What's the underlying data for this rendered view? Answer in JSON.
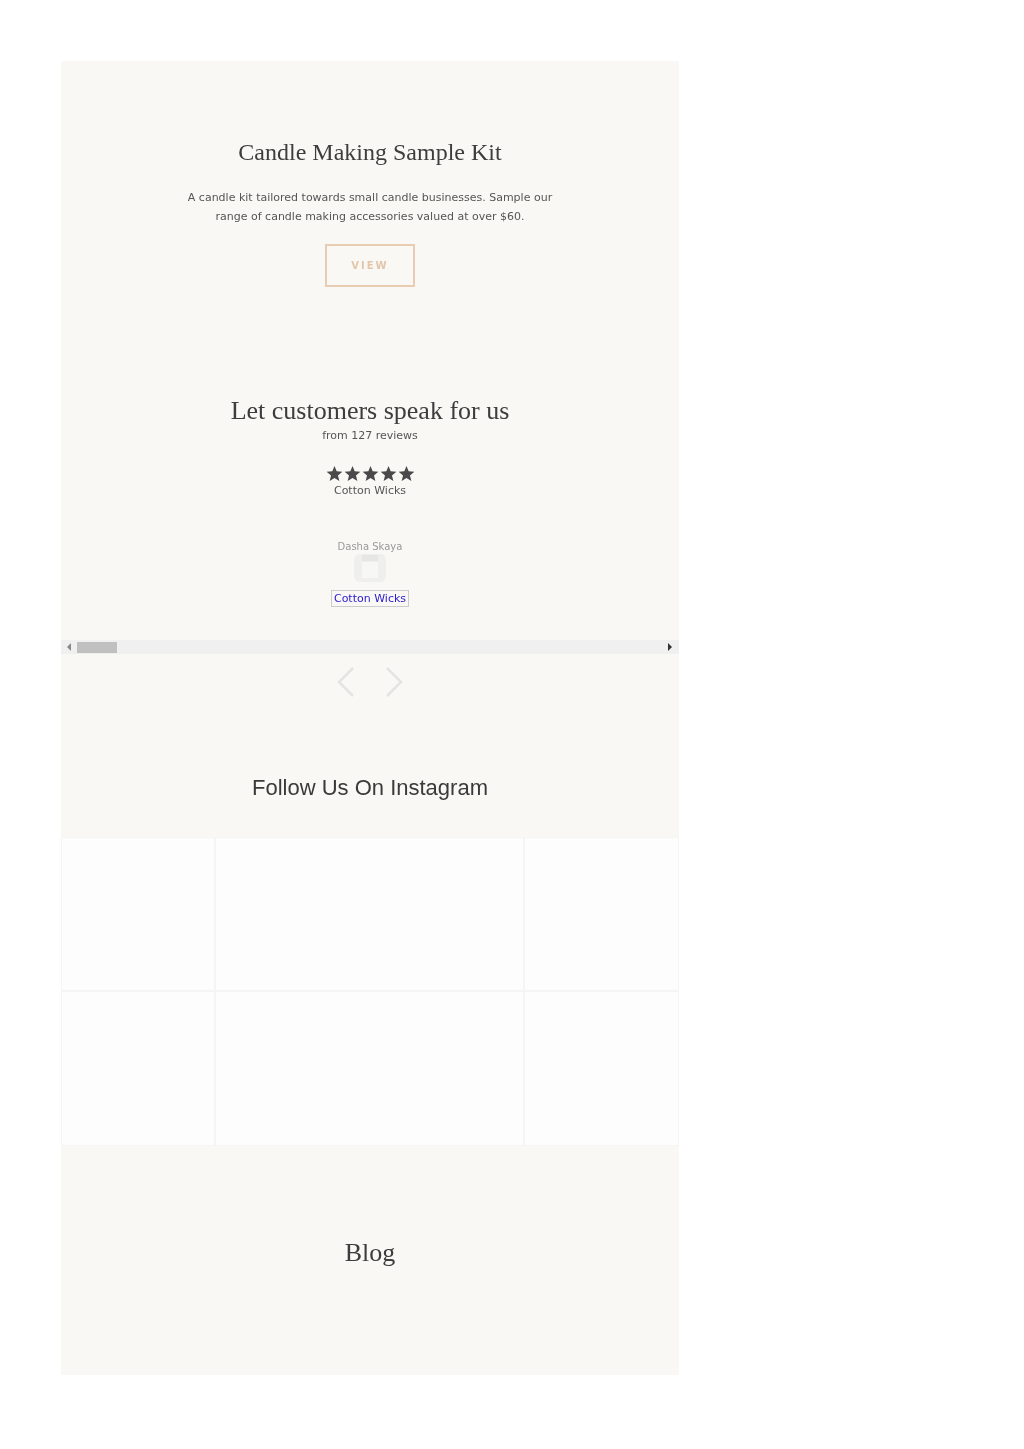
{
  "hero": {
    "title": "Candle Making Sample Kit",
    "description": "A candle kit tailored towards small candle businesses. Sample our range of candle making accessories valued at over $60.",
    "button": "VIEW"
  },
  "reviews": {
    "title": "Let customers speak for us",
    "subtitle": "from 127 reviews",
    "items": [
      {
        "stars": 5,
        "product": "Cotton Wicks",
        "author": "Dasha Skaya",
        "link": "Cotton Wicks"
      }
    ]
  },
  "instagram": {
    "title": "Follow Us On Instagram"
  },
  "blog": {
    "title": "Blog"
  }
}
